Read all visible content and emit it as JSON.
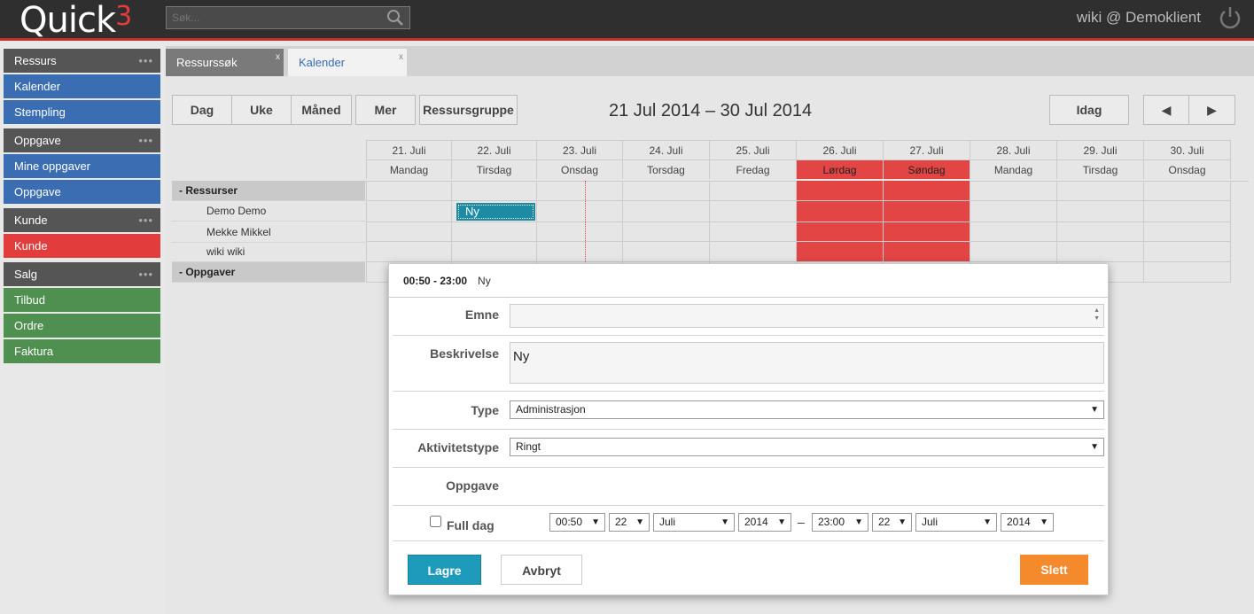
{
  "app": {
    "logo": "Quick",
    "logo_sup": "3",
    "user": "wiki @ Demoklient"
  },
  "search": {
    "placeholder": "Søk..."
  },
  "sidebar": {
    "groups": [
      {
        "title": "Ressurs",
        "dots": "•••",
        "items": [
          "Kalender",
          "Stempling"
        ]
      },
      {
        "title": "Oppgave",
        "dots": "•••",
        "items": [
          "Mine oppgaver",
          "Oppgave"
        ]
      },
      {
        "title": "Kunde",
        "dots": "•••",
        "items": [
          "Kunde"
        ]
      },
      {
        "title": "Salg",
        "dots": "•••",
        "items": [
          "Tilbud",
          "Ordre",
          "Faktura"
        ]
      }
    ]
  },
  "tabs": [
    {
      "label": "Ressurssøk",
      "close": "x"
    },
    {
      "label": "Kalender",
      "close": "x"
    }
  ],
  "toolbar": {
    "dag": "Dag",
    "uke": "Uke",
    "maned": "Måned",
    "mer": "Mer",
    "ressursgruppe": "Ressursgruppe",
    "idag": "Idag",
    "prev": "◀",
    "next": "▶"
  },
  "date_range": "21 Jul 2014 – 30 Jul 2014",
  "calendar": {
    "dates": [
      "21. Juli",
      "22. Juli",
      "23. Juli",
      "24. Juli",
      "25. Juli",
      "26. Juli",
      "27. Juli",
      "28. Juli",
      "29. Juli",
      "30. Juli"
    ],
    "days": [
      "Mandag",
      "Tirsdag",
      "Onsdag",
      "Torsdag",
      "Fredag",
      "Lørdag",
      "Søndag",
      "Mandag",
      "Tirsdag",
      "Onsdag"
    ],
    "group_resources": "-  Ressurser",
    "resources": [
      "Demo Demo",
      "Mekke Mikkel",
      "wiki wiki"
    ],
    "group_tasks": "-  Oppgaver",
    "event_label": "Ny",
    "weekend_color": "#e34545"
  },
  "dialog": {
    "time": "00:50 - 23:00",
    "title": "Ny",
    "labels": {
      "emne": "Emne",
      "beskrivelse": "Beskrivelse",
      "type": "Type",
      "aktivitetstype": "Aktivitetstype",
      "oppgave": "Oppgave",
      "full_dag": "Full dag"
    },
    "beskrivelse_value": "Ny",
    "type_value": "Administrasjon",
    "aktivitetstype_value": "Ringt",
    "start": {
      "time": "00:50",
      "day": "22",
      "month": "Juli",
      "year": "2014"
    },
    "separator": "–",
    "end": {
      "time": "23:00",
      "day": "22",
      "month": "Juli",
      "year": "2014"
    },
    "buttons": {
      "lagre": "Lagre",
      "avbryt": "Avbryt",
      "slett": "Slett"
    }
  }
}
